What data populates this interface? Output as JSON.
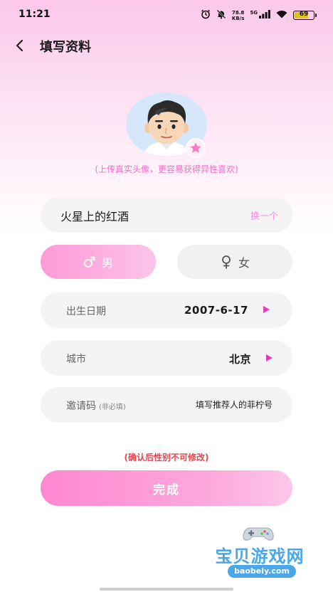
{
  "status_bar": {
    "time": "11:21",
    "net_speed_value": "78.8",
    "net_speed_unit": "KB/s",
    "signal_label": "5G",
    "battery_level": "69",
    "icons": [
      "alarm-icon",
      "mute-icon",
      "signal-icon",
      "wifi-icon",
      "battery-icon"
    ]
  },
  "nav": {
    "title": "填写资料",
    "back_icon": "chevron-left-icon"
  },
  "avatar": {
    "hint": "(上传真实头像，更容易获得异性喜欢)",
    "badge_icon": "star-icon"
  },
  "nickname": {
    "value": "火星上的红酒",
    "swap_label": "换一个"
  },
  "gender": {
    "male_label": "男",
    "female_label": "女",
    "selected": "male",
    "male_icon": "male-symbol-icon",
    "female_icon": "female-symbol-icon"
  },
  "birthday": {
    "label": "出生日期",
    "value": "2007-6-17"
  },
  "city": {
    "label": "城市",
    "value": "北京"
  },
  "invite": {
    "label": "邀请码",
    "label_note": "(非必填)",
    "placeholder": "填写推荐人的菲柠号"
  },
  "warning": "(确认后性别不可修改)",
  "submit_label": "完成",
  "watermark": {
    "text": "宝贝游戏网",
    "url": "baobeiy.com"
  },
  "colors": {
    "accent": "#fe87d1",
    "arrow": "#e23bbd",
    "warning": "#e5454d",
    "hint": "#f26fc4"
  }
}
